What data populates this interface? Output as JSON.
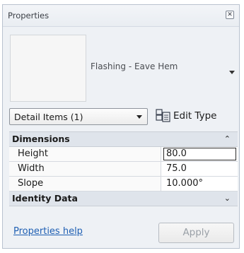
{
  "panel": {
    "title": "Properties",
    "close_icon": "close-icon"
  },
  "type_selector": {
    "type_name": "Flashing - Eave Hem"
  },
  "instance_selector": {
    "value": "Detail Items (1)",
    "edit_type_label": "Edit Type",
    "edit_type_icon": "edit-type-icon"
  },
  "groups": [
    {
      "label": "Dimensions",
      "state": "expanded",
      "rows": [
        {
          "name": "Height",
          "value": "80.0",
          "editing": true
        },
        {
          "name": "Width",
          "value": "75.0",
          "editing": false
        },
        {
          "name": "Slope",
          "value": "10.000°",
          "editing": false
        }
      ]
    },
    {
      "label": "Identity Data",
      "state": "collapsed",
      "rows": []
    }
  ],
  "footer": {
    "help_link": "Properties help",
    "apply_label": "Apply"
  },
  "colors": {
    "panel_bg": "#eef1f5",
    "group_bg": "#dfe4eb",
    "link": "#1f5fb3",
    "disabled_text": "#9aa0a7"
  }
}
